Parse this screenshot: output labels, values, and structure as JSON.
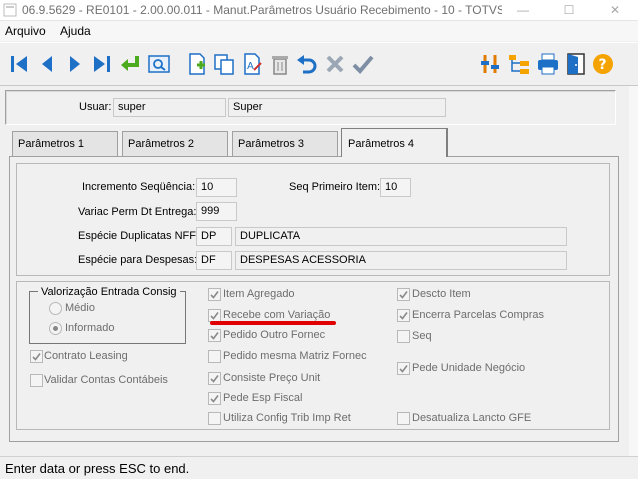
{
  "window": {
    "title": "06.9.5629 - RE0101 - 2.00.00.011 - Manut.Parâmetros Usuário Recebimento - 10 - TOTVS S...",
    "minimize": "—",
    "maximize": "☐",
    "close": "✕"
  },
  "menu": {
    "items": [
      "Arquivo",
      "Ajuda"
    ]
  },
  "user": {
    "label": "Usuar:",
    "code": "super",
    "name": "Super"
  },
  "tabs": [
    "Parâmetros 1",
    "Parâmetros 2",
    "Parâmetros 3",
    "Parâmetros 4"
  ],
  "active_tab": 3,
  "params": {
    "incremento_label": "Incremento Seqüência:",
    "incremento_value": "10",
    "seq_primeiro_label": "Seq Primeiro Item:",
    "seq_primeiro_value": "10",
    "variac_label": "Variac Perm Dt Entrega:",
    "variac_value": "999",
    "especie_dup_label": "Espécie Duplicatas NFF:",
    "especie_dup_code": "DP",
    "especie_dup_desc": "DUPLICATA",
    "especie_desp_label": "Espécie para Despesas:",
    "especie_desp_code": "DF",
    "especie_desp_desc": "DESPESAS ACESSORIA"
  },
  "valorizacao": {
    "title": "Valorização Entrada Consig",
    "options": [
      "Médio",
      "Informado"
    ],
    "selected": "Informado"
  },
  "checkboxes_left": [
    {
      "label": "Contrato Leasing",
      "checked": true
    },
    {
      "label": "Validar Contas Contábeis",
      "checked": false
    }
  ],
  "checkboxes_mid": [
    {
      "label": "Item Agregado",
      "checked": true
    },
    {
      "label": "Recebe com Variação",
      "checked": true
    },
    {
      "label": "Pedido Outro Fornec",
      "checked": true
    },
    {
      "label": "Pedido mesma Matriz Fornec",
      "checked": false
    },
    {
      "label": "Consiste Preço Unit",
      "checked": true
    },
    {
      "label": "Pede Esp Fiscal",
      "checked": true
    },
    {
      "label": "Utiliza Config Trib Imp Ret",
      "checked": false
    }
  ],
  "checkboxes_right": [
    {
      "label": "Descto Item",
      "checked": true
    },
    {
      "label": "Encerra Parcelas Compras",
      "checked": true
    },
    {
      "label": "Seq",
      "checked": false
    },
    {
      "label": "Pede Unidade Negócio",
      "checked": true
    },
    {
      "label": "Desatualiza Lancto GFE",
      "checked": false
    }
  ],
  "status": {
    "text": "Enter data or press ESC to end."
  },
  "colors": {
    "toolbar_blue": "#1e6fc6",
    "accent_red": "#e00000",
    "help_orange": "#f5a300"
  }
}
